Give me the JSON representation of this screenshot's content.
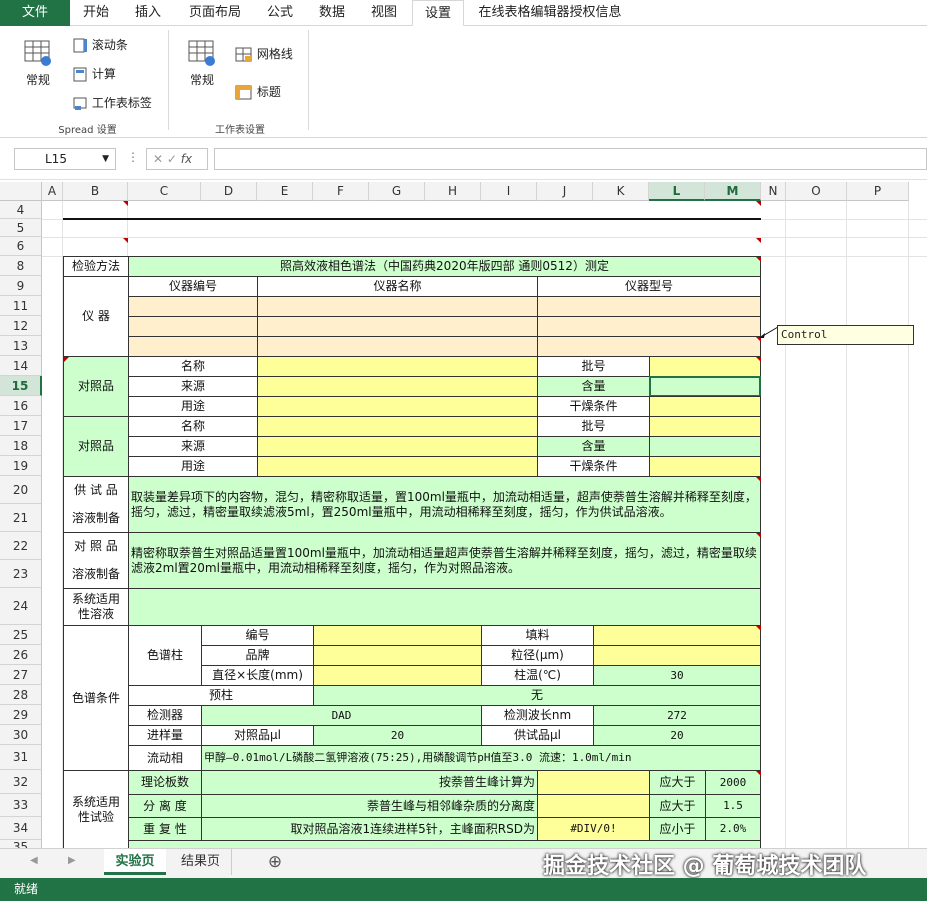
{
  "menu": {
    "tabs": [
      "文件",
      "开始",
      "插入",
      "页面布局",
      "公式",
      "数据",
      "视图",
      "设置",
      "在线表格编辑器授权信息"
    ],
    "active": "设置"
  },
  "ribbon": {
    "g1_big": "常规",
    "g1_items": [
      "滚动条",
      "计算",
      "工作表标签"
    ],
    "g1_label": "Spread 设置",
    "g2_big": "常规",
    "g2_items": [
      "网格线",
      "标题"
    ],
    "g2_label": "工作表设置"
  },
  "formula_bar": {
    "name_box": "L15",
    "fx": "fx",
    "value": ""
  },
  "columns": [
    "A",
    "B",
    "C",
    "D",
    "E",
    "F",
    "G",
    "H",
    "I",
    "J",
    "K",
    "L",
    "M",
    "N",
    "O",
    "P"
  ],
  "selected_columns": [
    "L",
    "M"
  ],
  "rows": [
    "4",
    "5",
    "6",
    "8",
    "9",
    "11",
    "12",
    "13",
    "14",
    "15",
    "16",
    "17",
    "18",
    "19",
    "20",
    "21",
    "22",
    "23",
    "24",
    "25",
    "26",
    "27",
    "28",
    "29",
    "30",
    "31",
    "32",
    "33",
    "34",
    "35"
  ],
  "selected_row": "15",
  "sheet": {
    "r8_label": "检验方法",
    "r8_value": "照高效液相色谱法（中国药典2020年版四部 通则0512）测定",
    "instrument_label": "仪    器",
    "instrument_headers": [
      "仪器编号",
      "仪器名称",
      "仪器型号"
    ],
    "ref1_label": "对照品",
    "ref2_label": "对照品",
    "ref_fields": [
      "名称",
      "来源",
      "用途"
    ],
    "ref_right_fields": [
      "批号",
      "含量",
      "干燥条件"
    ],
    "sample_label_1": "供 试 品",
    "sample_label_2": "溶液制备",
    "sample_text": "取装量差异项下的内容物，混匀，精密称取适量，置100ml量瓶中，加流动相适量，超声使萘普生溶解并稀释至刻度，摇匀，滤过，精密量取续滤液5ml，置250ml量瓶中，用流动相稀释至刻度，摇匀，作为供试品溶液。",
    "refsol_label_1": "对 照 品",
    "refsol_label_2": "溶液制备",
    "refsol_text": "精密称取萘普生对照品适量置100ml量瓶中，加流动相适量超声使萘普生溶解并稀释至刻度，摇匀，滤过，精密量取续滤液2ml置20ml量瓶中，用流动相稀释至刻度，摇匀，作为对照品溶液。",
    "sst_sol_label": "系统适用性溶液",
    "chrom_label": "色谱条件",
    "column_label": "色谱柱",
    "col_fields": [
      "编号",
      "品牌",
      "直径×长度(mm)"
    ],
    "col_right_fields": [
      "填料",
      "粒径(μm)",
      "柱温(℃)"
    ],
    "col_temp": "30",
    "precol_label": "预柱",
    "precol_value": "无",
    "detector_label": "检测器",
    "detector_value": "DAD",
    "wavelength_label": "检测波长nm",
    "wavelength_value": "272",
    "inj_label": "进样量",
    "inj_ref_label": "对照品μl",
    "inj_ref_value": "20",
    "inj_sample_label": "供试品μl",
    "inj_sample_value": "20",
    "mobile_label": "流动相",
    "mobile_value": "甲醇—0.01mol/L磷酸二氢钾溶液(75:25),用磷酸调节pH值至3.0    流速：1.0ml/min",
    "sst_label": "系统适用性试验",
    "sst_rows": [
      {
        "label": "理论板数",
        "desc": "按萘普生峰计算为",
        "val": "",
        "cmp": "应大于",
        "limit": "2000"
      },
      {
        "label": "分 离 度",
        "desc": "萘普生峰与相邻峰杂质的分离度",
        "val": "",
        "cmp": "应大于",
        "limit": "1.5"
      },
      {
        "label": "重 复 性",
        "desc": "取对照品溶液1连续进样5针，主峰面积RSD为",
        "val": "#DIV/0!",
        "cmp": "应小于",
        "limit": "2.0%"
      }
    ]
  },
  "comment": "Control",
  "tabs": {
    "sheets": [
      "实验页",
      "结果页"
    ],
    "active": "实验页"
  },
  "status": "就绪",
  "watermark": "掘金技术社区 @ 葡萄城技术团队"
}
